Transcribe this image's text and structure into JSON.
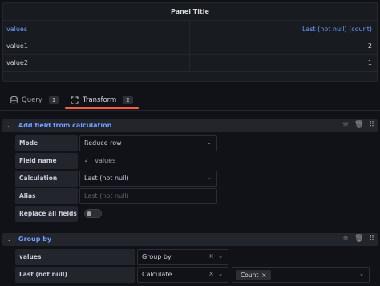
{
  "panel": {
    "title": "Panel Title",
    "columns": [
      "values",
      "Last (not null) (count)"
    ],
    "rows": [
      {
        "name": "value1",
        "count": "2"
      },
      {
        "name": "value2",
        "count": "1"
      }
    ]
  },
  "tabs": [
    {
      "label": "Query",
      "count": "1",
      "icon": "database-icon"
    },
    {
      "label": "Transform",
      "count": "2",
      "icon": "transform-icon",
      "active": true
    }
  ],
  "transforms": {
    "add_field": {
      "title": "Add field from calculation",
      "mode_label": "Mode",
      "mode_value": "Reduce row",
      "field_name_label": "Field name",
      "field_name_value": "values",
      "calculation_label": "Calculation",
      "calculation_value": "Last (not null)",
      "alias_label": "Alias",
      "alias_placeholder": "Last (not null)",
      "replace_label": "Replace all fields",
      "replace_on": false
    },
    "group_by": {
      "title": "Group by",
      "row1_label": "values",
      "row1_value": "Group by",
      "row2_label": "Last (not null)",
      "row2_value": "Calculate",
      "row2_chip": "Count"
    }
  },
  "icons": {
    "debug": "bug-icon",
    "delete": "trash-icon",
    "drag": "drag-handle-icon"
  },
  "colors": {
    "accent_blue": "#6e9fff",
    "tab_underline": "#f55f3e"
  }
}
